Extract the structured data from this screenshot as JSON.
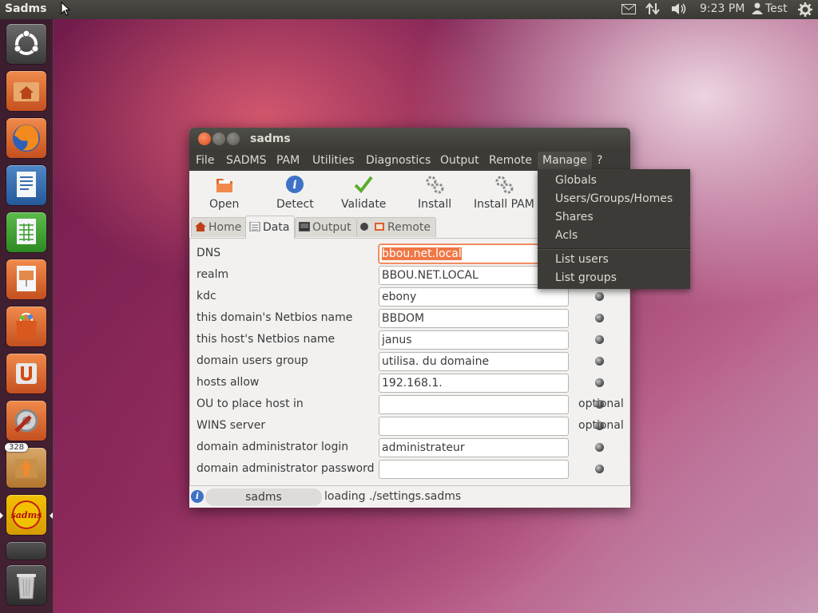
{
  "top_panel": {
    "app_title": "Sadms",
    "clock": "9:23 PM",
    "user": "Test",
    "indicators": [
      "mail-icon",
      "network-icon",
      "volume-icon",
      "user-icon",
      "session-gear-icon"
    ]
  },
  "launcher": {
    "items": [
      {
        "name": "dash-home",
        "icon": "ubuntu-logo-icon"
      },
      {
        "name": "home-folder",
        "icon": "home-folder-icon"
      },
      {
        "name": "firefox",
        "icon": "firefox-icon"
      },
      {
        "name": "libreoffice-writer",
        "icon": "writer-icon"
      },
      {
        "name": "libreoffice-calc",
        "icon": "calc-icon"
      },
      {
        "name": "libreoffice-impress",
        "icon": "impress-icon"
      },
      {
        "name": "software-center",
        "icon": "shopping-bag-icon"
      },
      {
        "name": "ubuntu-one",
        "icon": "ubuntu-one-icon"
      },
      {
        "name": "system-settings",
        "icon": "settings-wrench-icon"
      },
      {
        "name": "update-manager",
        "icon": "update-icon",
        "badge": "328"
      },
      {
        "name": "sadms",
        "icon": "sadms-icon"
      },
      {
        "name": "workspaces",
        "icon": "workspace-icon"
      },
      {
        "name": "trash",
        "icon": "trash-icon"
      }
    ]
  },
  "window": {
    "title": "sadms",
    "menu": [
      "File",
      "SADMS",
      "PAM",
      "Utilities",
      "Diagnostics",
      "Output",
      "Remote",
      "Manage",
      "?"
    ],
    "toolbar": [
      "Open",
      "Detect",
      "Validate",
      "Install",
      "Install PAM"
    ],
    "tabs": [
      "Home",
      "Data",
      "Output",
      "Remote"
    ],
    "form": [
      {
        "label": "DNS",
        "value": "bbou.net.local"
      },
      {
        "label": "realm",
        "value": "BBOU.NET.LOCAL"
      },
      {
        "label": "kdc",
        "value": "ebony"
      },
      {
        "label": "this domain's Netbios name",
        "value": "BBDOM"
      },
      {
        "label": "this host's Netbios name",
        "value": "janus"
      },
      {
        "label": "domain users group",
        "value": "utilisa. du domaine"
      },
      {
        "label": "hosts allow",
        "value": "192.168.1."
      },
      {
        "label": "OU to place host in",
        "value": "",
        "note": "optional"
      },
      {
        "label": "WINS server",
        "value": "",
        "note": "optional"
      },
      {
        "label": "domain administrator login",
        "value": "administrateur"
      },
      {
        "label": "domain administrator password",
        "value": ""
      }
    ],
    "status": {
      "module": "sadms",
      "message": "loading ./settings.sadms"
    }
  },
  "manage_menu": {
    "items": [
      "Globals",
      "Users/Groups/Homes",
      "Shares",
      "Acls",
      "List users",
      "List groups"
    ]
  },
  "colors": {
    "accent": "#f07746",
    "panel": "#3c3b37",
    "window_bg": "#f2f1f0"
  }
}
